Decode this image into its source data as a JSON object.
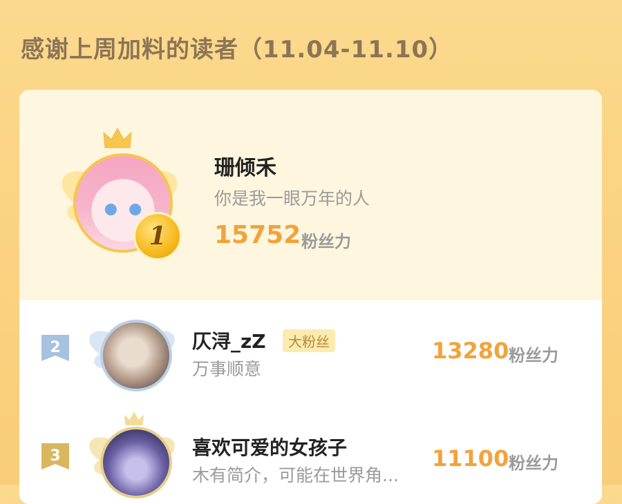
{
  "header": {
    "title": "感谢上周加料的读者（11.04-11.10）"
  },
  "ranking": [
    {
      "rank": "1",
      "name": "珊倾禾",
      "bio": "你是我一眼万年的人",
      "score": "15752",
      "unit": "粉丝力"
    },
    {
      "rank": "2",
      "name": "仄浔_zZ",
      "tag": "大粉丝",
      "bio": "万事顺意",
      "score": "13280",
      "unit": "粉丝力"
    },
    {
      "rank": "3",
      "name": "喜欢可爱的女孩子",
      "bio": "木有简介，可能在世界角...",
      "score": "11100",
      "unit": "粉丝力"
    }
  ],
  "colors": {
    "accent": "#f1a33b",
    "gold": "#f6c64e",
    "silver": "#9fb9d8",
    "bronze": "#d9b75f"
  },
  "icons": [
    "crown-icon",
    "wings-icon",
    "rank-medal-icon",
    "rank-badge-icon"
  ]
}
